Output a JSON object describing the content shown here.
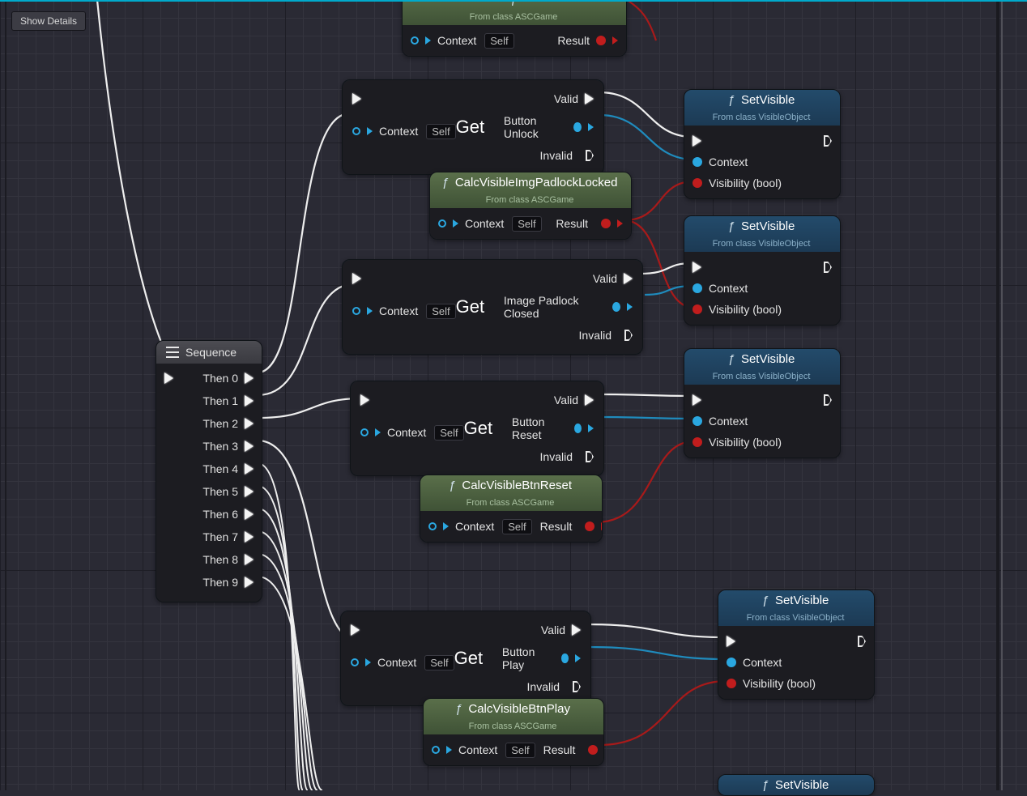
{
  "toolbar": {
    "show_details": "Show Details"
  },
  "sequence": {
    "title": "Sequence",
    "pins": [
      "Then 0",
      "Then 1",
      "Then 2",
      "Then 3",
      "Then 4",
      "Then 5",
      "Then 6",
      "Then 7",
      "Then 8",
      "Then 9"
    ]
  },
  "labels": {
    "context": "Context",
    "self": "Self",
    "result": "Result",
    "valid": "Valid",
    "invalid": "Invalid",
    "get": "Get",
    "visibility": "Visibility (bool)"
  },
  "calc_top": {
    "subtitle": "From class ASCGame"
  },
  "calc_padlock": {
    "title": "CalcVisibleImgPadlockLocked",
    "subtitle": "From class ASCGame"
  },
  "calc_reset": {
    "title": "CalcVisibleBtnReset",
    "subtitle": "From class ASCGame"
  },
  "calc_play": {
    "title": "CalcVisibleBtnPlay",
    "subtitle": "From class ASCGame"
  },
  "get1": {
    "output": "Button Unlock"
  },
  "get2": {
    "output": "Image Padlock Closed"
  },
  "get3": {
    "output": "Button Reset"
  },
  "get4": {
    "output": "Button Play"
  },
  "setvisible": {
    "title": "SetVisible",
    "subtitle": "From class VisibleObject"
  },
  "setvisible_partial": {
    "title": "SetVisible"
  }
}
